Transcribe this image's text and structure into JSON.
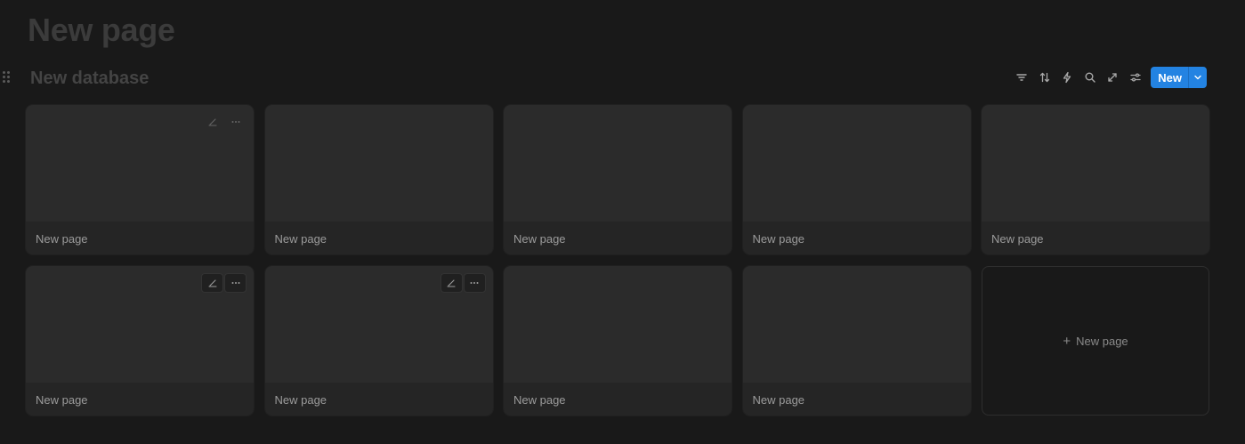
{
  "page": {
    "title": "New page"
  },
  "database": {
    "title": "New database",
    "toolbar": {
      "icons": [
        "filter-icon",
        "sort-icon",
        "lightning-icon",
        "search-icon",
        "expand-icon",
        "settings-sliders-icon"
      ],
      "new_label": "New"
    },
    "cards": [
      {
        "title": "New page",
        "actions": "faint"
      },
      {
        "title": "New page",
        "actions": "none"
      },
      {
        "title": "New page",
        "actions": "none"
      },
      {
        "title": "New page",
        "actions": "none"
      },
      {
        "title": "New page",
        "actions": "none"
      },
      {
        "title": "New page",
        "actions": "visible"
      },
      {
        "title": "New page",
        "actions": "visible"
      },
      {
        "title": "New page",
        "actions": "none"
      },
      {
        "title": "New page",
        "actions": "none"
      }
    ],
    "add_card": {
      "plus": "+",
      "label": "New page"
    }
  },
  "colors": {
    "background": "#191919",
    "card": "#252525",
    "card_cover": "#2b2b2b",
    "accent": "#2383e2"
  }
}
